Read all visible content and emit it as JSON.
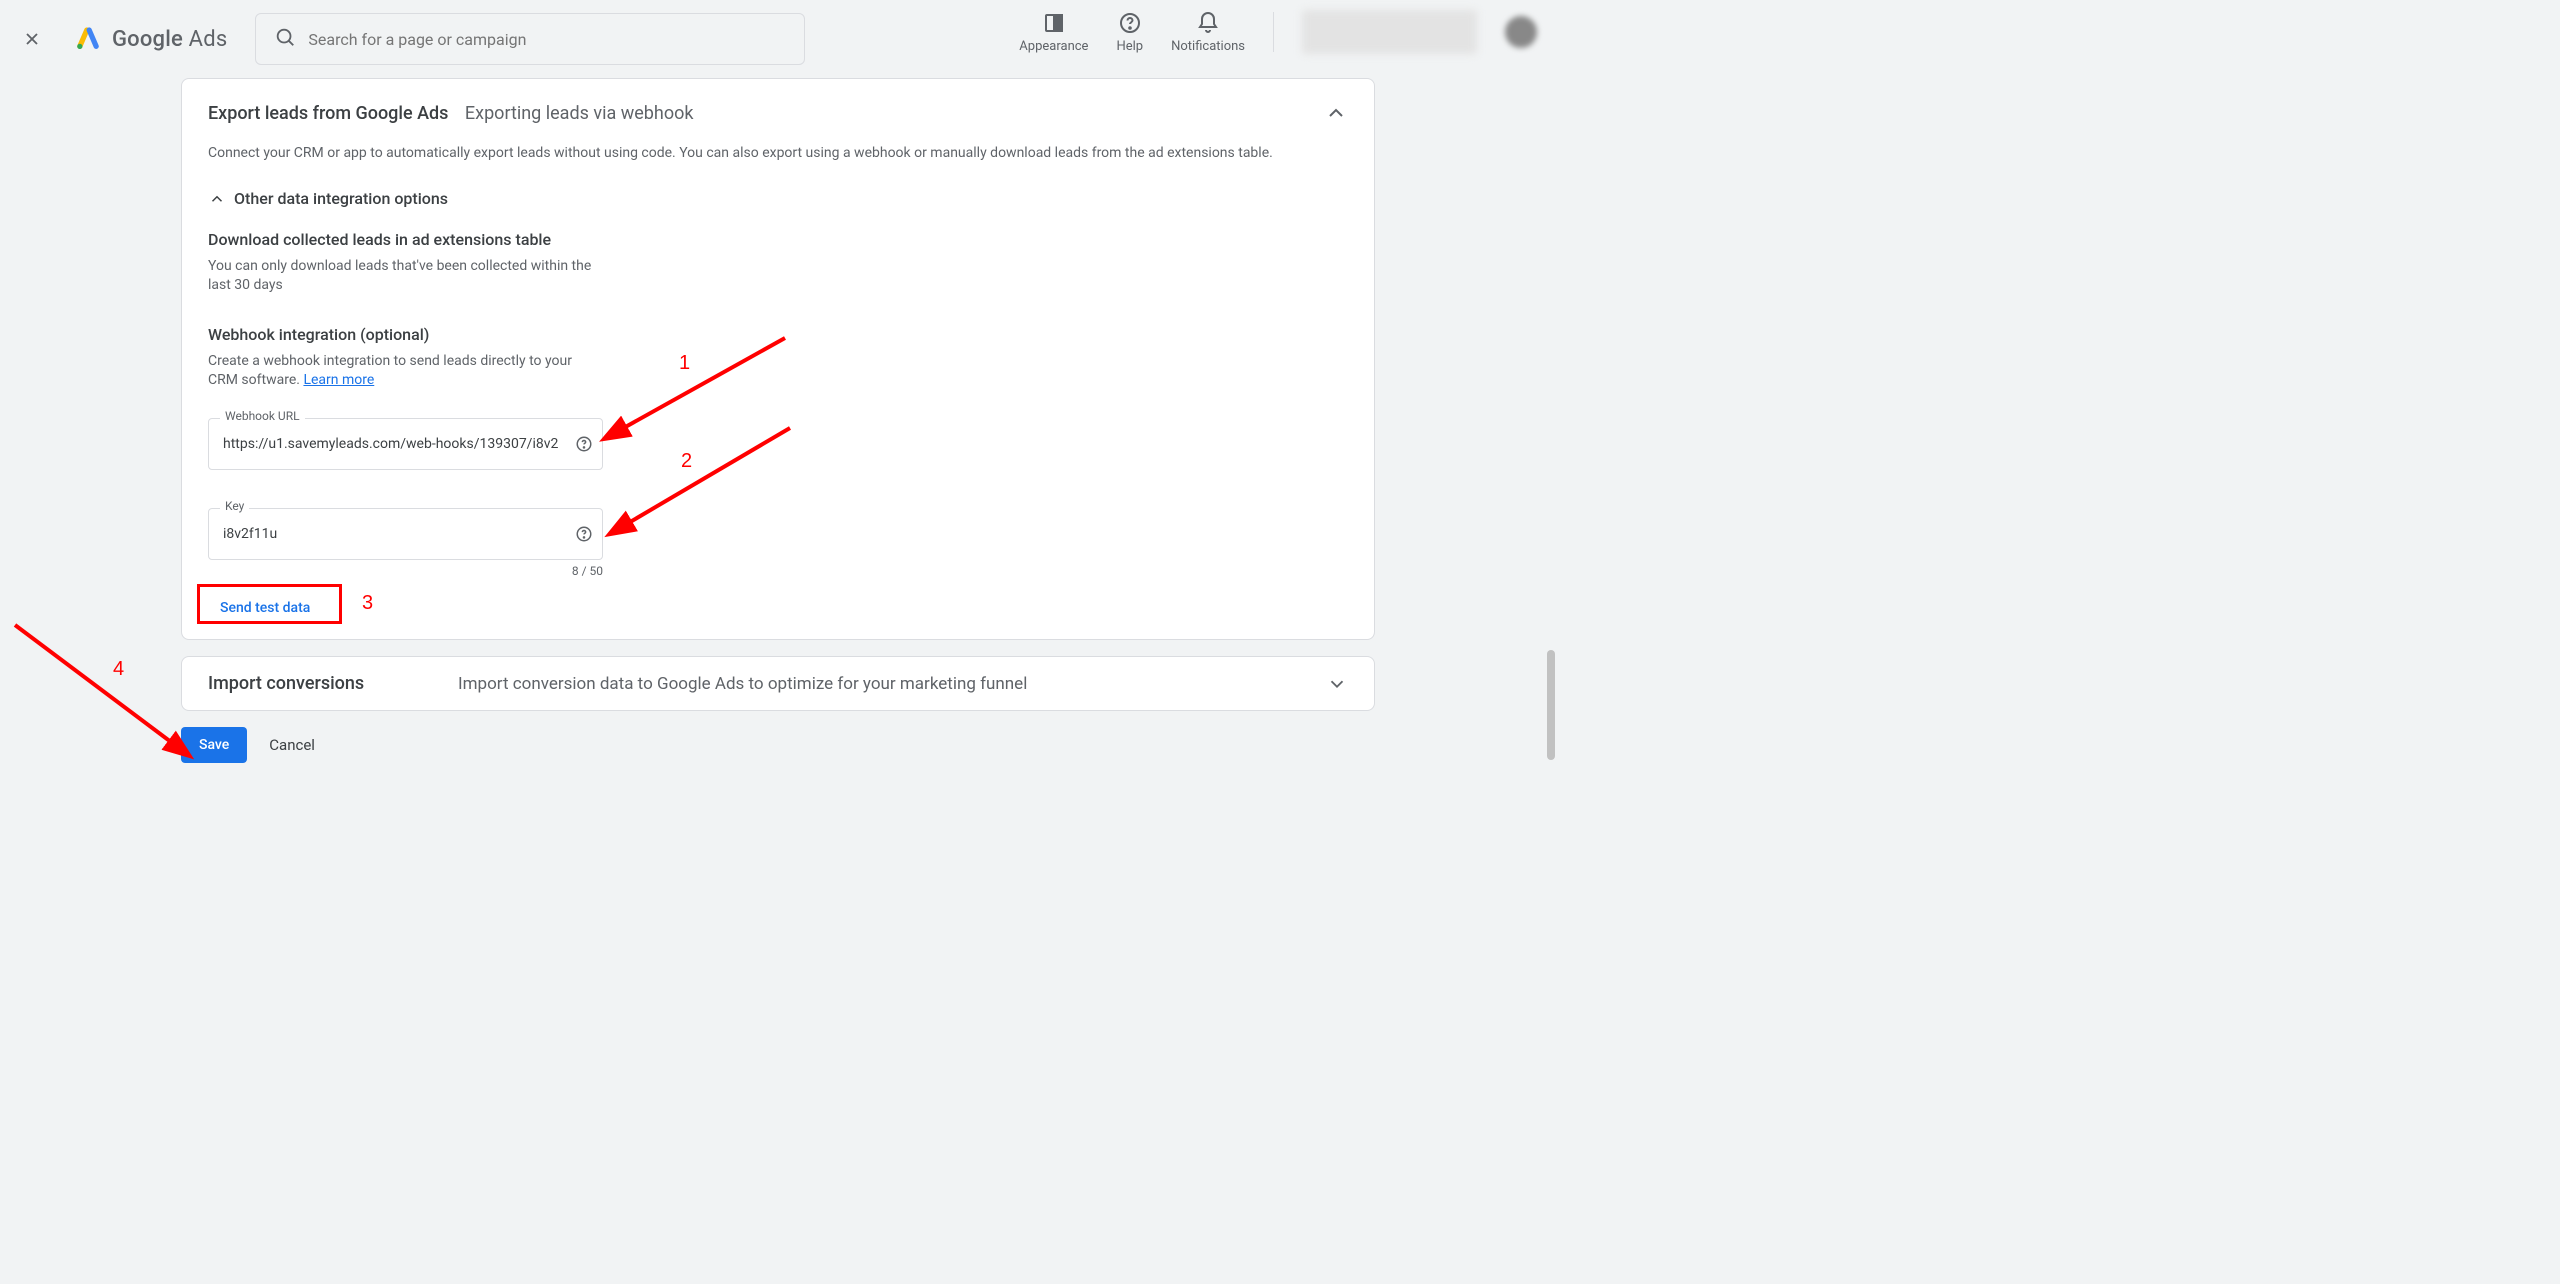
{
  "header": {
    "logo_text_bold": "Google",
    "logo_text_rest": " Ads",
    "search_placeholder": "Search for a page or campaign",
    "tools": {
      "appearance": "Appearance",
      "help": "Help",
      "notifications": "Notifications"
    }
  },
  "export_card": {
    "title": "Export leads from Google Ads",
    "subtitle": "Exporting leads via webhook",
    "description": "Connect your CRM or app to automatically export leads without using code. You can also export using a webhook or manually download leads from the ad extensions table.",
    "options_header": "Other data integration options",
    "download_header": "Download collected leads in ad extensions table",
    "download_desc": "You can only download leads that've been collected within the last 30 days",
    "webhook_header": "Webhook integration (optional)",
    "webhook_desc_prefix": "Create a webhook integration to send leads directly to your CRM software. ",
    "learn_more": "Learn more",
    "url_label": "Webhook URL",
    "url_value": "https://u1.savemyleads.com/web-hooks/139307/i8v2",
    "key_label": "Key",
    "key_value": "i8v2f11u",
    "key_counter": "8 / 50",
    "send_test": "Send test data"
  },
  "import_card": {
    "title": "Import conversions",
    "subtitle": "Import conversion data to Google Ads to optimize for your marketing funnel"
  },
  "buttons": {
    "save": "Save",
    "cancel": "Cancel"
  },
  "annotations": {
    "n1": "1",
    "n2": "2",
    "n3": "3",
    "n4": "4"
  }
}
